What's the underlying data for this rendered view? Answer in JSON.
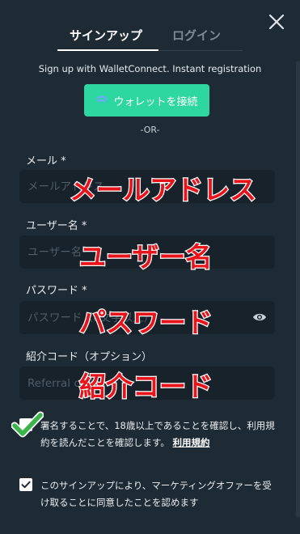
{
  "tabs": [
    {
      "label": "サインアップ"
    },
    {
      "label": "ログイン"
    }
  ],
  "intro": "Sign up with WalletConnect. Instant registration",
  "wallet_button": {
    "label": "ウォレットを接続",
    "icon": "walletconnect-icon"
  },
  "or_text": "-OR-",
  "fields": {
    "email": {
      "label": "メール *",
      "placeholder": "メールアドレス",
      "value": ""
    },
    "username": {
      "label": "ユーザー名 *",
      "placeholder": "ユーザー名",
      "value": ""
    },
    "password": {
      "label": "パスワード *",
      "placeholder": "パスワード（8文字以上）",
      "value": ""
    },
    "referral": {
      "label": "紹介コード（オプション）",
      "placeholder": "Referral code",
      "value": ""
    }
  },
  "annotations": {
    "email": "メールアドレス",
    "username": "ユーザー名",
    "password": "パスワード",
    "referral": "紹介コード"
  },
  "terms": {
    "checked": true,
    "text": "署名することで、18歳以上であることを確認し、利用規約を読んだことを確認します。",
    "link": "利用規約"
  },
  "marketing": {
    "checked": true,
    "text": "このサインアップにより、マーケティングオファーを受け取ることに同意したことを認めます"
  },
  "colors": {
    "background": "#1e2a34",
    "input_bg": "#17222b",
    "accent": "#2ed6a0",
    "annotation": "#e8141c",
    "check_green": "#3bb54a"
  }
}
